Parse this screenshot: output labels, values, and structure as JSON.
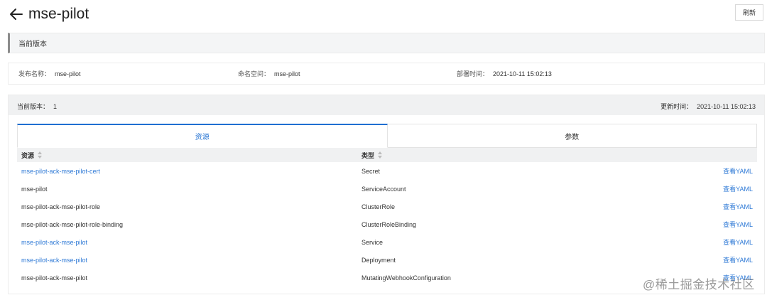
{
  "header": {
    "title": "mse-pilot",
    "refresh_label": "刷新"
  },
  "section": {
    "title": "当前版本"
  },
  "info": {
    "release_name_label": "发布名称：",
    "release_name": "mse-pilot",
    "namespace_label": "命名空间：",
    "namespace": "mse-pilot",
    "deploy_time_label": "部署时间：",
    "deploy_time": "2021-10-11 15:02:13"
  },
  "version": {
    "current_label": "当前版本：",
    "current": "1",
    "updated_label": "更新时间：",
    "updated": "2021-10-11 15:02:13"
  },
  "tabs": [
    {
      "label": "资源",
      "active": true
    },
    {
      "label": "参数",
      "active": false
    }
  ],
  "table": {
    "columns": [
      {
        "label": "资源"
      },
      {
        "label": "类型"
      }
    ],
    "rows": [
      {
        "name": "mse-pilot-ack-mse-pilot-cert",
        "type": "Secret",
        "action": "查看YAML",
        "link": true
      },
      {
        "name": "mse-pilot",
        "type": "ServiceAccount",
        "action": "查看YAML",
        "link": false
      },
      {
        "name": "mse-pilot-ack-mse-pilot-role",
        "type": "ClusterRole",
        "action": "查看YAML",
        "link": false
      },
      {
        "name": "mse-pilot-ack-mse-pilot-role-binding",
        "type": "ClusterRoleBinding",
        "action": "查看YAML",
        "link": false
      },
      {
        "name": "mse-pilot-ack-mse-pilot",
        "type": "Service",
        "action": "查看YAML",
        "link": true
      },
      {
        "name": "mse-pilot-ack-mse-pilot",
        "type": "Deployment",
        "action": "查看YAML",
        "link": true
      },
      {
        "name": "mse-pilot-ack-mse-pilot",
        "type": "MutatingWebhookConfiguration",
        "action": "查看YAML",
        "link": false
      }
    ]
  },
  "watermark": "@稀土掘金技术社区",
  "colors": {
    "accent": "#1f6fd1",
    "link": "#2f7ad6"
  }
}
